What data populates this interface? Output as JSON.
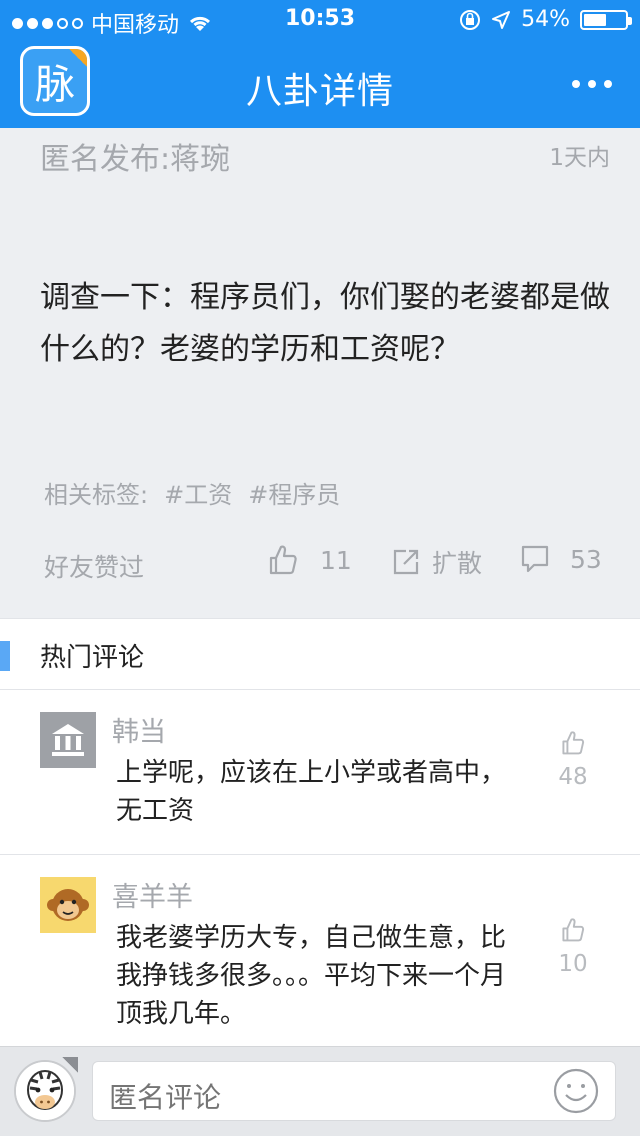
{
  "status_bar": {
    "carrier": "中国移动",
    "time": "10:53",
    "battery": "54%",
    "battery_level": 0.54,
    "signal_bars_filled": 3,
    "signal_bars_total": 5
  },
  "header": {
    "logo_text": "脉",
    "title": "八卦详情",
    "background": "#1d8ff2"
  },
  "post": {
    "author": "匿名发布:蒋琬",
    "age": "1天内",
    "content": "调查一下：程序员们，你们娶的老婆都是做什么的？老婆的学历和工资呢？",
    "tags_label": "相关标签:",
    "tags": [
      "#工资",
      "#程序员"
    ],
    "friends_label": "好友赞过",
    "like_count": "11",
    "share_label": "扩散",
    "comment_count": "53"
  },
  "hot_comments": {
    "title": "热门评论",
    "items": [
      {
        "name": "韩当",
        "text": "上学呢，应该在上小学或者高中，无工资",
        "likes": "48",
        "avatar": "bank-icon"
      },
      {
        "name": "喜羊羊",
        "text": "我老婆学历大专，自己做生意，比我挣钱多很多。。。平均下来一个月顶我几年。",
        "likes": "10",
        "avatar": "monkey-avatar"
      }
    ]
  },
  "composer": {
    "placeholder": "匿名评论",
    "my_avatar": "zebra-avatar",
    "emoji_icon": "smiley-icon"
  },
  "colors": {
    "accent": "#1d8ff2",
    "muted_text": "#a5a8ad",
    "post_background": "#edeff2",
    "hot_bar": "#5aa8f5"
  }
}
